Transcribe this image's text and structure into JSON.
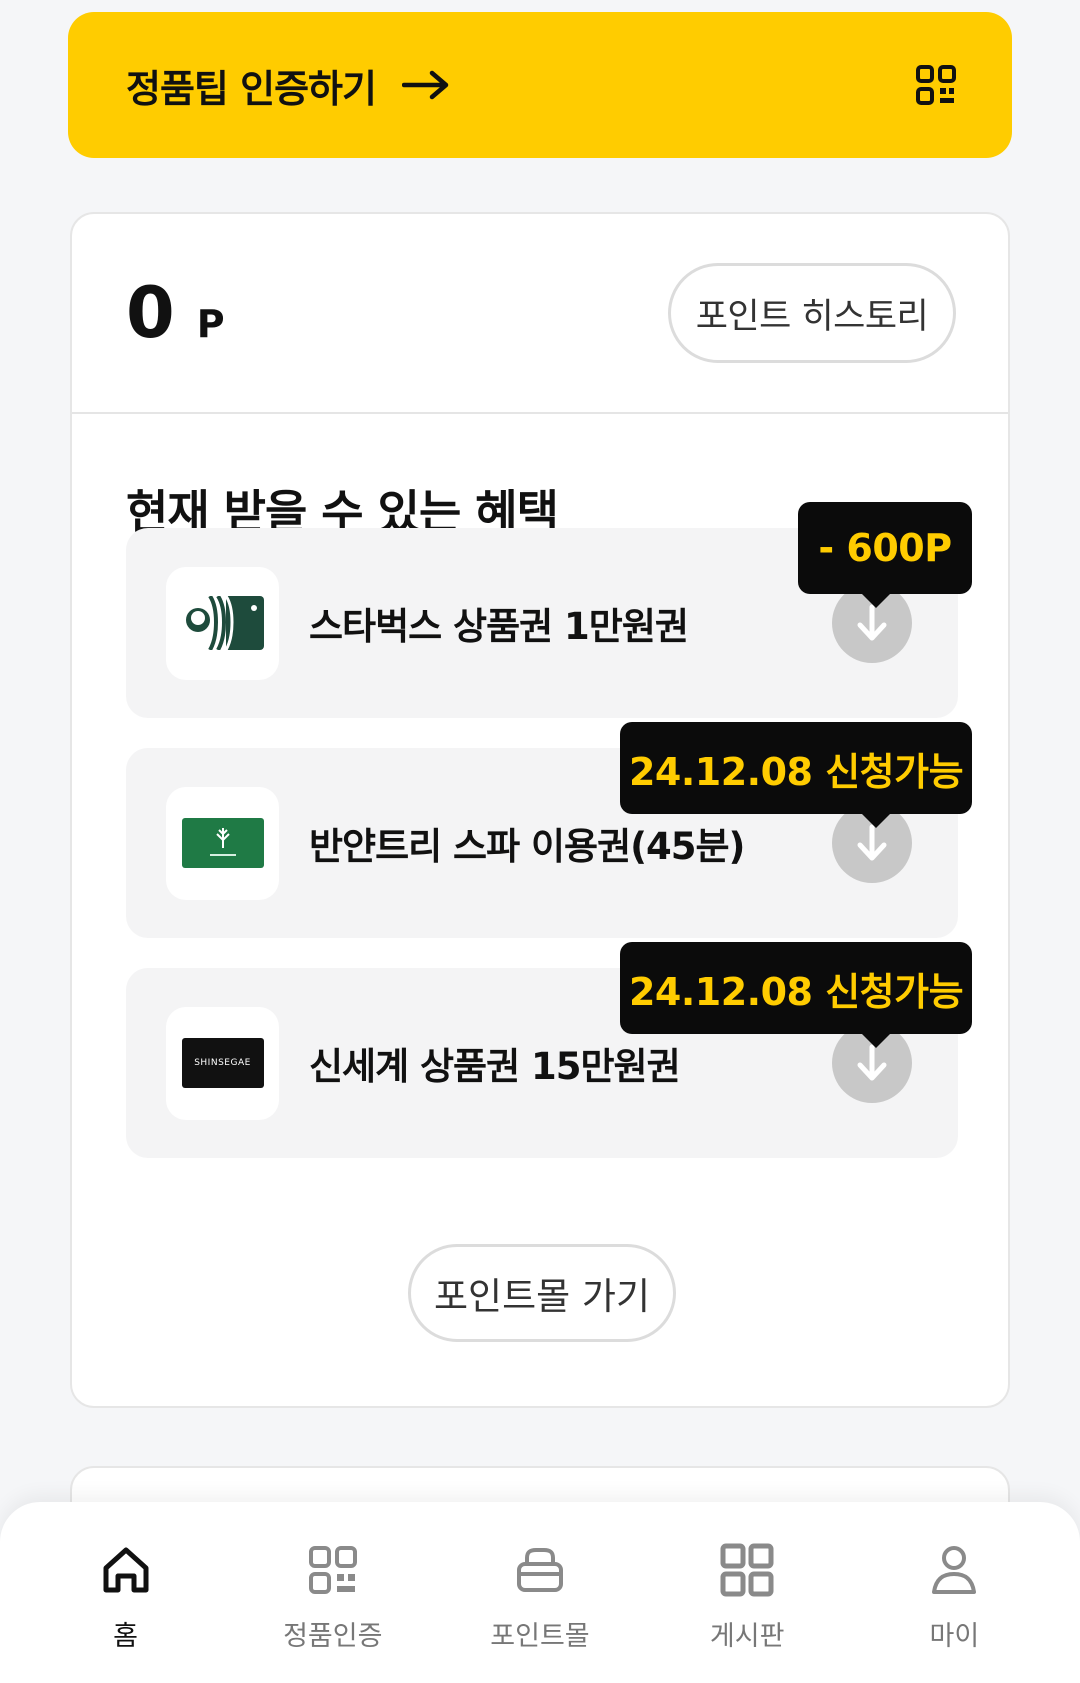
{
  "banner": {
    "title": "정품팁 인증하기",
    "background": "#ffcc00"
  },
  "points": {
    "value": "0",
    "unit": "P",
    "history_button": "포인트 히스토리"
  },
  "benefits": {
    "title": "현재 받을 수 있는 혜택",
    "items": [
      {
        "name": "스타벅스  상품권 1만원권",
        "badge": "- 600P",
        "thumb": "starbucks-card"
      },
      {
        "name": "반얀트리  스파 이용권(45분)",
        "badge": "24.12.08 신청가능",
        "thumb": "banyan-tree-card"
      },
      {
        "name": "신세계 상품권 15만원권",
        "badge": "24.12.08 신청가능",
        "thumb": "shinsegae-card",
        "thumb_text": "SHINSEGAE"
      }
    ]
  },
  "mall_button": "포인트몰 가기",
  "nav": {
    "items": [
      {
        "label": "홈",
        "icon": "home-icon",
        "active": true
      },
      {
        "label": "정품인증",
        "icon": "qr-icon",
        "active": false
      },
      {
        "label": "포인트몰",
        "icon": "shop-icon",
        "active": false
      },
      {
        "label": "게시판",
        "icon": "grid-icon",
        "active": false
      },
      {
        "label": "마이",
        "icon": "person-icon",
        "active": false
      }
    ]
  },
  "colors": {
    "accent": "#ffcc00",
    "tooltip_bg": "#0b0b0b",
    "download_button": "#c8c8c8"
  }
}
